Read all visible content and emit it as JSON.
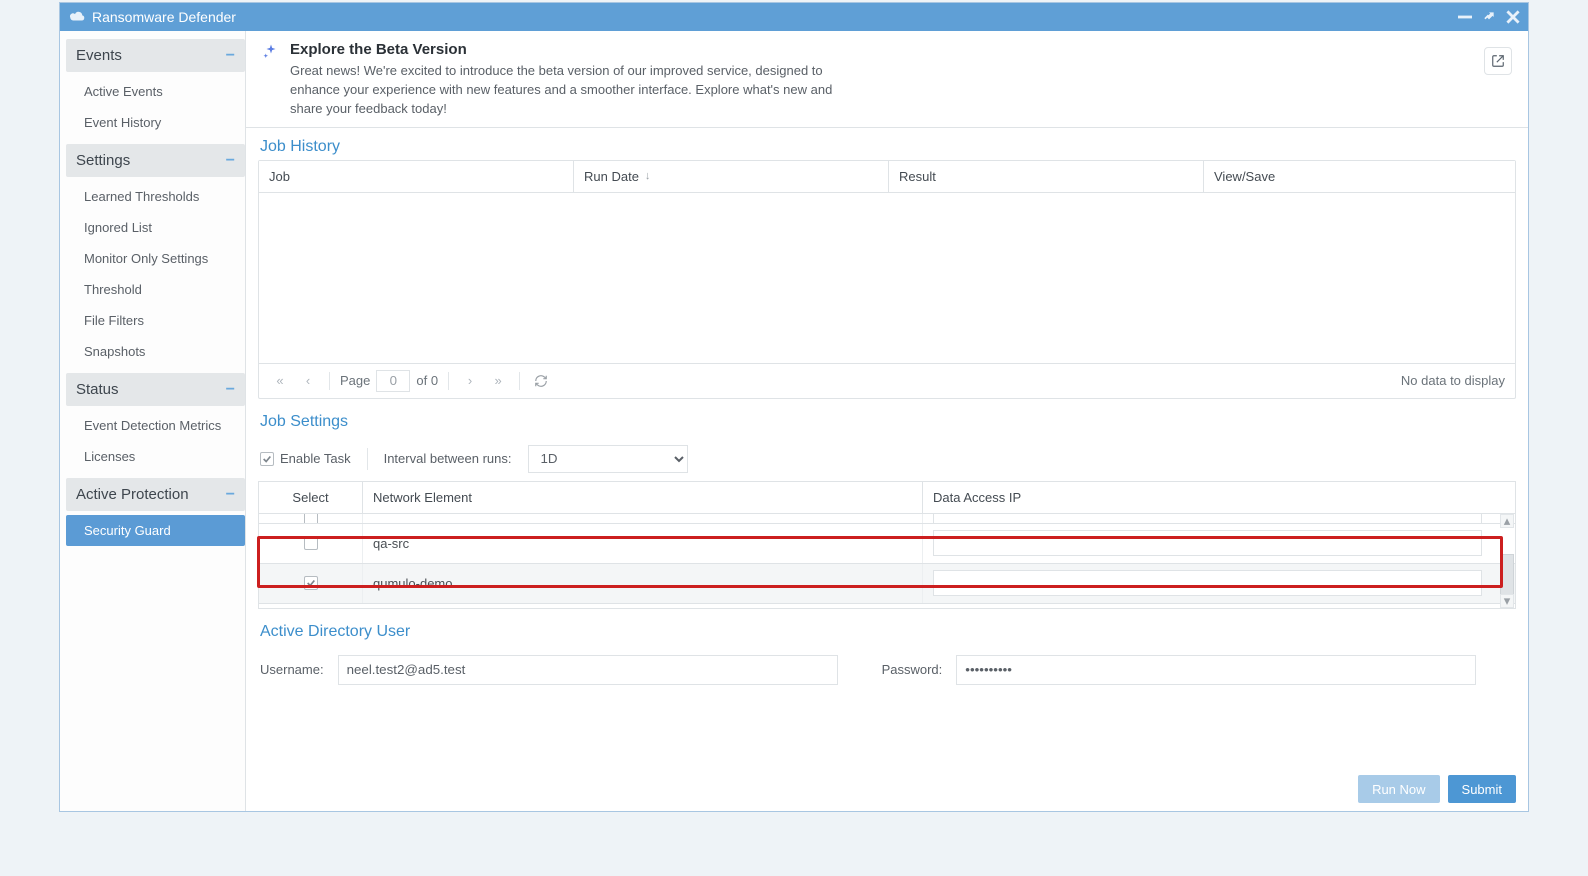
{
  "window": {
    "title": "Ransomware Defender"
  },
  "sidebar": {
    "groups": [
      {
        "label": "Events",
        "items": [
          {
            "label": "Active Events",
            "active": false
          },
          {
            "label": "Event History",
            "active": false
          }
        ]
      },
      {
        "label": "Settings",
        "items": [
          {
            "label": "Learned Thresholds"
          },
          {
            "label": "Ignored List"
          },
          {
            "label": "Monitor Only Settings"
          },
          {
            "label": "Threshold"
          },
          {
            "label": "File Filters"
          },
          {
            "label": "Snapshots"
          }
        ]
      },
      {
        "label": "Status",
        "items": [
          {
            "label": "Event Detection Metrics"
          },
          {
            "label": "Licenses"
          }
        ]
      },
      {
        "label": "Active Protection",
        "items": [
          {
            "label": "Security Guard",
            "active": true
          }
        ]
      }
    ]
  },
  "banner": {
    "title": "Explore the Beta Version",
    "desc": "Great news! We're excited to introduce the beta version of our improved service, designed to enhance your experience with new features and a smoother interface. Explore what's new and share your feedback today!"
  },
  "jobHistory": {
    "title": "Job History",
    "columns": {
      "job": "Job",
      "runDate": "Run Date",
      "result": "Result",
      "viewSave": "View/Save"
    },
    "pager": {
      "pageLabel": "Page",
      "pageValue": "0",
      "ofLabel": "of 0",
      "empty": "No data to display"
    }
  },
  "jobSettings": {
    "title": "Job Settings",
    "enableLabel": "Enable Task",
    "enableChecked": true,
    "intervalLabel": "Interval between runs:",
    "intervalValue": "1D",
    "columns": {
      "select": "Select",
      "ne": "Network Element",
      "ip": "Data Access IP"
    },
    "rows": [
      {
        "name": "",
        "checked": false,
        "partial": true
      },
      {
        "name": "qa-src",
        "checked": false,
        "ip": ""
      },
      {
        "name": "qumulo-demo",
        "checked": true,
        "ip": "",
        "highlight": true
      }
    ]
  },
  "adUser": {
    "title": "Active Directory User",
    "usernameLabel": "Username:",
    "username": "neel.test2@ad5.test",
    "passwordLabel": "Password:",
    "password": "••••••••••"
  },
  "buttons": {
    "runNow": "Run Now",
    "submit": "Submit"
  }
}
